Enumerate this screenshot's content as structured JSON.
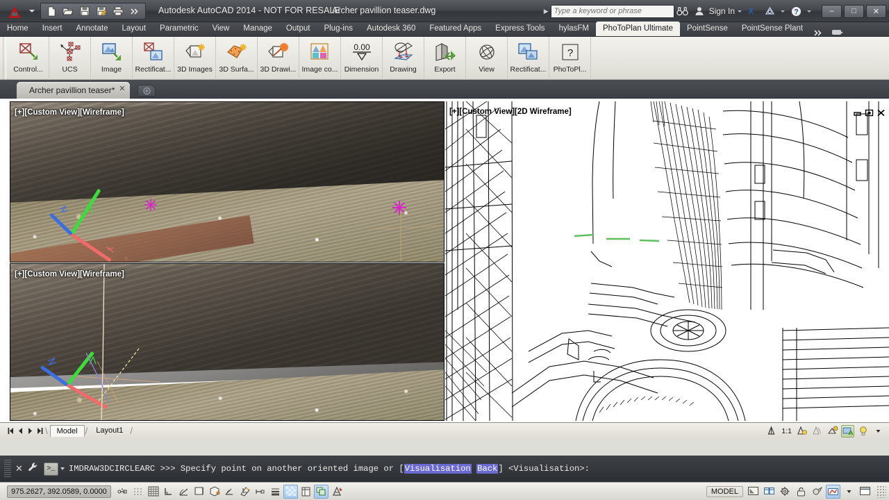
{
  "app": {
    "title": "Autodesk AutoCAD 2014 - NOT FOR RESALE",
    "document": "Archer pavillion teaser.dwg"
  },
  "quick_access": {
    "app_menu": "autocad-a-logo",
    "items": [
      {
        "name": "new-file-icon",
        "label": "New"
      },
      {
        "name": "open-file-icon",
        "label": "Open"
      },
      {
        "name": "save-icon",
        "label": "Save"
      },
      {
        "name": "save-as-icon",
        "label": "Save As"
      },
      {
        "name": "plot-icon",
        "label": "Plot"
      },
      {
        "name": "overflow-icon",
        "label": "More"
      }
    ]
  },
  "infocenter": {
    "placeholder": "Type a keyword or phrase",
    "search_icon": "binoculars-icon",
    "account_icon": "person-icon",
    "sign_in": "Sign In",
    "exchange_icon": "autodesk-exchange-icon",
    "help_icon": "help-icon"
  },
  "window_controls": {
    "minimize": "–",
    "maximize": "□",
    "close": "✕"
  },
  "ribbon_tabs": {
    "items": [
      "Home",
      "Insert",
      "Annotate",
      "Layout",
      "Parametric",
      "View",
      "Manage",
      "Output",
      "Plug-ins",
      "Autodesk 360",
      "Featured Apps",
      "Express Tools",
      "hylasFM",
      "PhoToPlan Ultimate",
      "PointSense",
      "PointSense Plant"
    ],
    "active": "PhoToPlan Ultimate",
    "overflow_label": "»"
  },
  "ribbon_panel": {
    "buttons": [
      {
        "label": "Control...",
        "icon": "control-points-icon"
      },
      {
        "label": "UCS",
        "icon": "ucs-icon"
      },
      {
        "label": "Image",
        "icon": "image-icon"
      },
      {
        "label": "Rectificat...",
        "icon": "rectification-icon"
      },
      {
        "label": "3D Images",
        "icon": "3d-images-icon"
      },
      {
        "label": "3D Surfa...",
        "icon": "3d-surfaces-icon"
      },
      {
        "label": "3D Drawi...",
        "icon": "3d-drawing-icon"
      },
      {
        "label": "Image co...",
        "icon": "image-correction-icon"
      },
      {
        "label": "Dimension",
        "icon": "dimension-icon",
        "glyph": "0.00"
      },
      {
        "label": "Drawing",
        "icon": "drawing-icon"
      },
      {
        "label": "Export",
        "icon": "export-icon"
      },
      {
        "label": "View",
        "icon": "view-icon"
      },
      {
        "label": "Rectificat...",
        "icon": "rectification-panel-icon"
      },
      {
        "label": "PhoToPl...",
        "icon": "phototoplan-help-icon",
        "glyph": "?"
      }
    ]
  },
  "file_tabs": {
    "active_tab": "Archer pavillion teaser*",
    "close_glyph": "✕",
    "new_tab_icon": "new-drawing-tab-icon"
  },
  "viewports": [
    {
      "name": "viewport-top-left",
      "label": "[+][Custom View][Wireframe]",
      "kind": "photo"
    },
    {
      "name": "viewport-bottom-left",
      "label": "[+][Custom View][Wireframe]",
      "kind": "photo"
    },
    {
      "name": "viewport-right",
      "label": "[+][Custom View][2D Wireframe]",
      "kind": "wireframe"
    }
  ],
  "drawing_window_buttons": {
    "minimize": "–",
    "restore": "▣",
    "close": "✕"
  },
  "model_tabs": {
    "nav": [
      "first-layout-icon",
      "prev-layout-icon",
      "next-layout-icon",
      "last-layout-icon"
    ],
    "tabs": [
      "Model",
      "Layout1"
    ],
    "active": "Model",
    "right_tools": [
      {
        "name": "annotation-scale-icon",
        "label": ""
      },
      {
        "name": "scale-value",
        "label": "1:1"
      },
      {
        "name": "annotation-visibility-icon",
        "label": ""
      },
      {
        "name": "annotation-add-scales-icon",
        "label": ""
      },
      {
        "name": "viewport-lock-icon",
        "label": ""
      },
      {
        "name": "annotation-monitor-icon",
        "label": ""
      },
      {
        "name": "light-bulb-icon",
        "label": ""
      },
      {
        "name": "dropdown-caret-icon",
        "label": "▾"
      }
    ]
  },
  "command_line": {
    "close_glyph": "✕",
    "settings_icon": "wrench-icon",
    "prompt_icon": "command-prompt-icon",
    "command": "IMDRAW3DCIRCLEARC",
    "separator": ">>>",
    "text_before": "Specify point on another oriented image or [",
    "keyword_1": "Visualisation",
    "keyword_2": "Back",
    "text_after": "] <Visualisation>:"
  },
  "status_bar": {
    "coordinates": "975.2627, 392.0589, 0.0000",
    "toggles": [
      {
        "name": "infer-constraints-toggle",
        "on": false
      },
      {
        "name": "snap-mode-toggle",
        "on": false
      },
      {
        "name": "grid-display-toggle",
        "on": false
      },
      {
        "name": "ortho-mode-toggle",
        "on": false
      },
      {
        "name": "polar-tracking-toggle",
        "on": false
      },
      {
        "name": "object-snap-toggle",
        "on": false
      },
      {
        "name": "3d-object-snap-toggle",
        "on": false
      },
      {
        "name": "object-snap-tracking-toggle",
        "on": false
      },
      {
        "name": "dynamic-ucs-toggle",
        "on": false
      },
      {
        "name": "dynamic-input-toggle",
        "on": false
      },
      {
        "name": "lineweight-toggle",
        "on": false
      },
      {
        "name": "transparency-toggle",
        "on": true
      },
      {
        "name": "quick-properties-toggle",
        "on": false
      },
      {
        "name": "selection-cycling-toggle",
        "on": true
      },
      {
        "name": "annotation-monitor-toggle",
        "on": false
      }
    ],
    "space_label": "MODEL",
    "right_tools": [
      {
        "name": "quick-view-layouts-icon",
        "on": false
      },
      {
        "name": "quick-view-drawings-icon",
        "on": false
      },
      {
        "name": "workspace-switching-icon",
        "on": false
      },
      {
        "name": "toolbar-lock-icon",
        "on": false
      },
      {
        "name": "isolate-objects-icon",
        "on": false
      },
      {
        "name": "hardware-acceleration-icon",
        "on": true
      },
      {
        "name": "status-overflow-caret-icon",
        "on": false
      },
      {
        "name": "clean-screen-icon",
        "on": false
      }
    ]
  },
  "colors": {
    "accent_red": "#b01a1a",
    "ribbon_bg": "#eceae4",
    "titlebar_dark": "#3d4146",
    "keyword_highlight": "#6a6ad0",
    "axis_x": "#f06a6a",
    "axis_y": "#3ddc3d",
    "axis_z": "#3b6fe0",
    "marker_magenta": "#d828c8"
  }
}
